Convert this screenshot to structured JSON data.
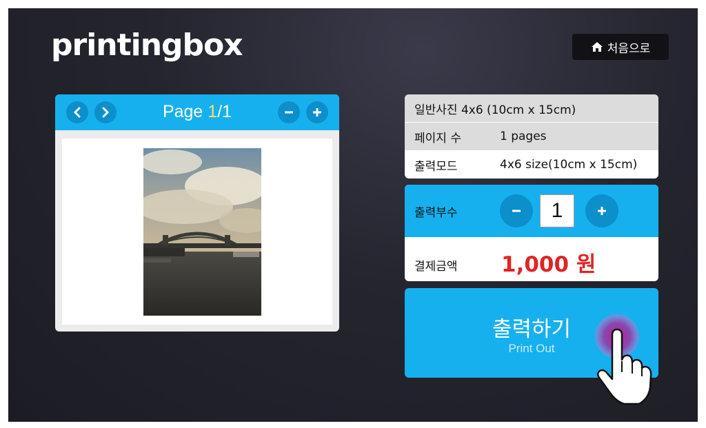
{
  "header": {
    "logo": "printingbox",
    "home_label": "처음으로"
  },
  "preview": {
    "page_prefix": "Page ",
    "page_current": "1",
    "page_sep_total": "/1"
  },
  "info": {
    "product": "일반사진 4x6 (10cm x 15cm)",
    "pages_label": "페이지 수",
    "pages_value": "1 pages",
    "mode_label": "출력모드",
    "mode_value": "4x6 size(10cm x 15cm)"
  },
  "order": {
    "copies_label": "출력부수",
    "copies_value": "1",
    "price_label": "결제금액",
    "price_value": "1,000 원"
  },
  "print_button": {
    "label_ko": "출력하기",
    "label_en": "Print Out"
  },
  "icons": [
    "home-icon",
    "chevron-left-icon",
    "chevron-right-icon",
    "minus-icon",
    "plus-icon",
    "hand-pointer-icon"
  ],
  "colors": {
    "accent": "#17b0ee",
    "accent_dark": "#0c8fcb",
    "price": "#e02424",
    "page_highlight": "#f7e26a",
    "background": "#25252f"
  }
}
